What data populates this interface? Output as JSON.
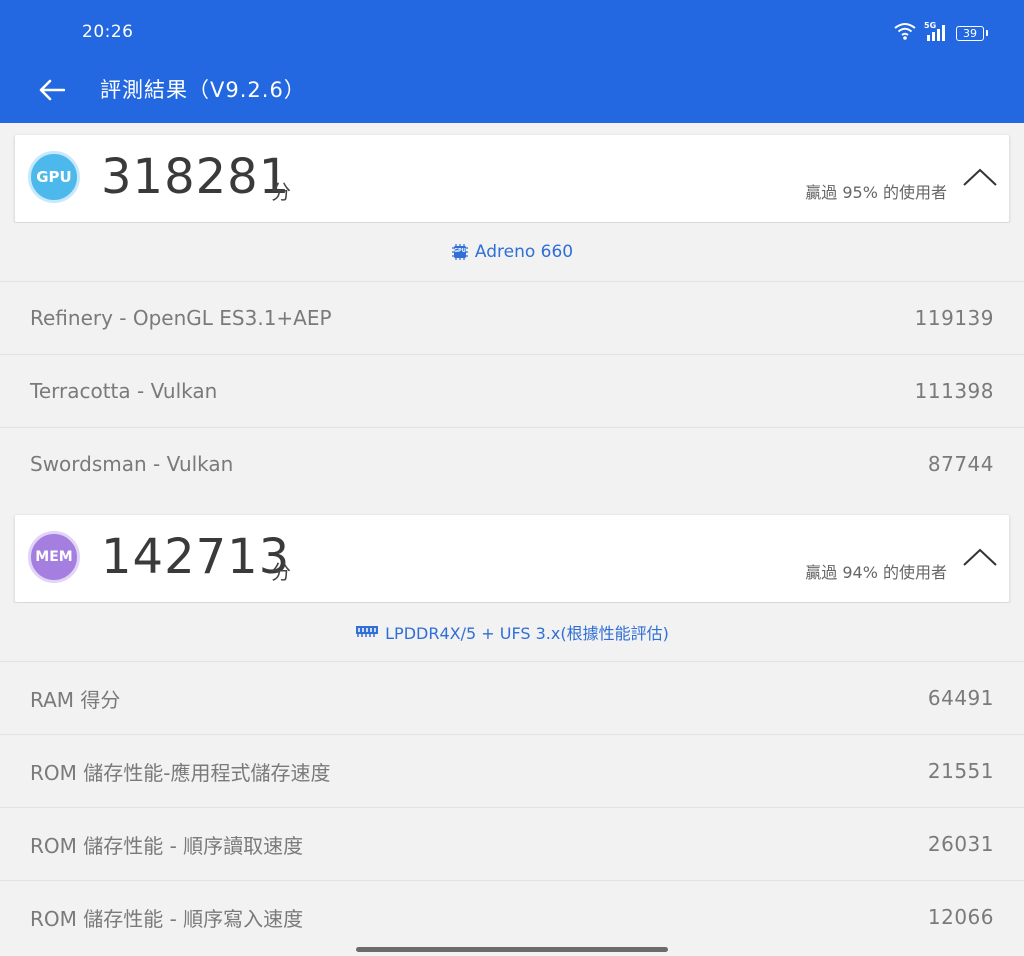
{
  "status": {
    "time": "20:26",
    "signal_label": "5G",
    "battery": "39"
  },
  "header": {
    "title": "評測結果（V9.2.6）"
  },
  "gpu": {
    "badge": "GPU",
    "score": "318281",
    "unit": "分",
    "rank": "贏過 95% 的使用者",
    "device": "Adreno 660",
    "device_icon_label": "GPU",
    "tests": [
      {
        "name": "Refinery - OpenGL ES3.1+AEP",
        "score": "119139"
      },
      {
        "name": "Terracotta - Vulkan",
        "score": "111398"
      },
      {
        "name": "Swordsman - Vulkan",
        "score": "87744"
      }
    ]
  },
  "mem": {
    "badge": "MEM",
    "score": "142713",
    "unit": "分",
    "rank": "贏過 94% 的使用者",
    "device": "LPDDR4X/5 + UFS 3.x(根據性能評估)",
    "tests": [
      {
        "name": "RAM 得分",
        "score": "64491"
      },
      {
        "name": "ROM 儲存性能-應用程式儲存速度",
        "score": "21551"
      },
      {
        "name": "ROM 儲存性能 - 順序讀取速度",
        "score": "26031"
      },
      {
        "name": "ROM 儲存性能 - 順序寫入速度",
        "score": "12066"
      }
    ]
  },
  "colors": {
    "primary": "#2368e0",
    "link": "#2f6fd6",
    "gpu_badge": "#4db8ec",
    "mem_badge": "#a57fe0"
  }
}
